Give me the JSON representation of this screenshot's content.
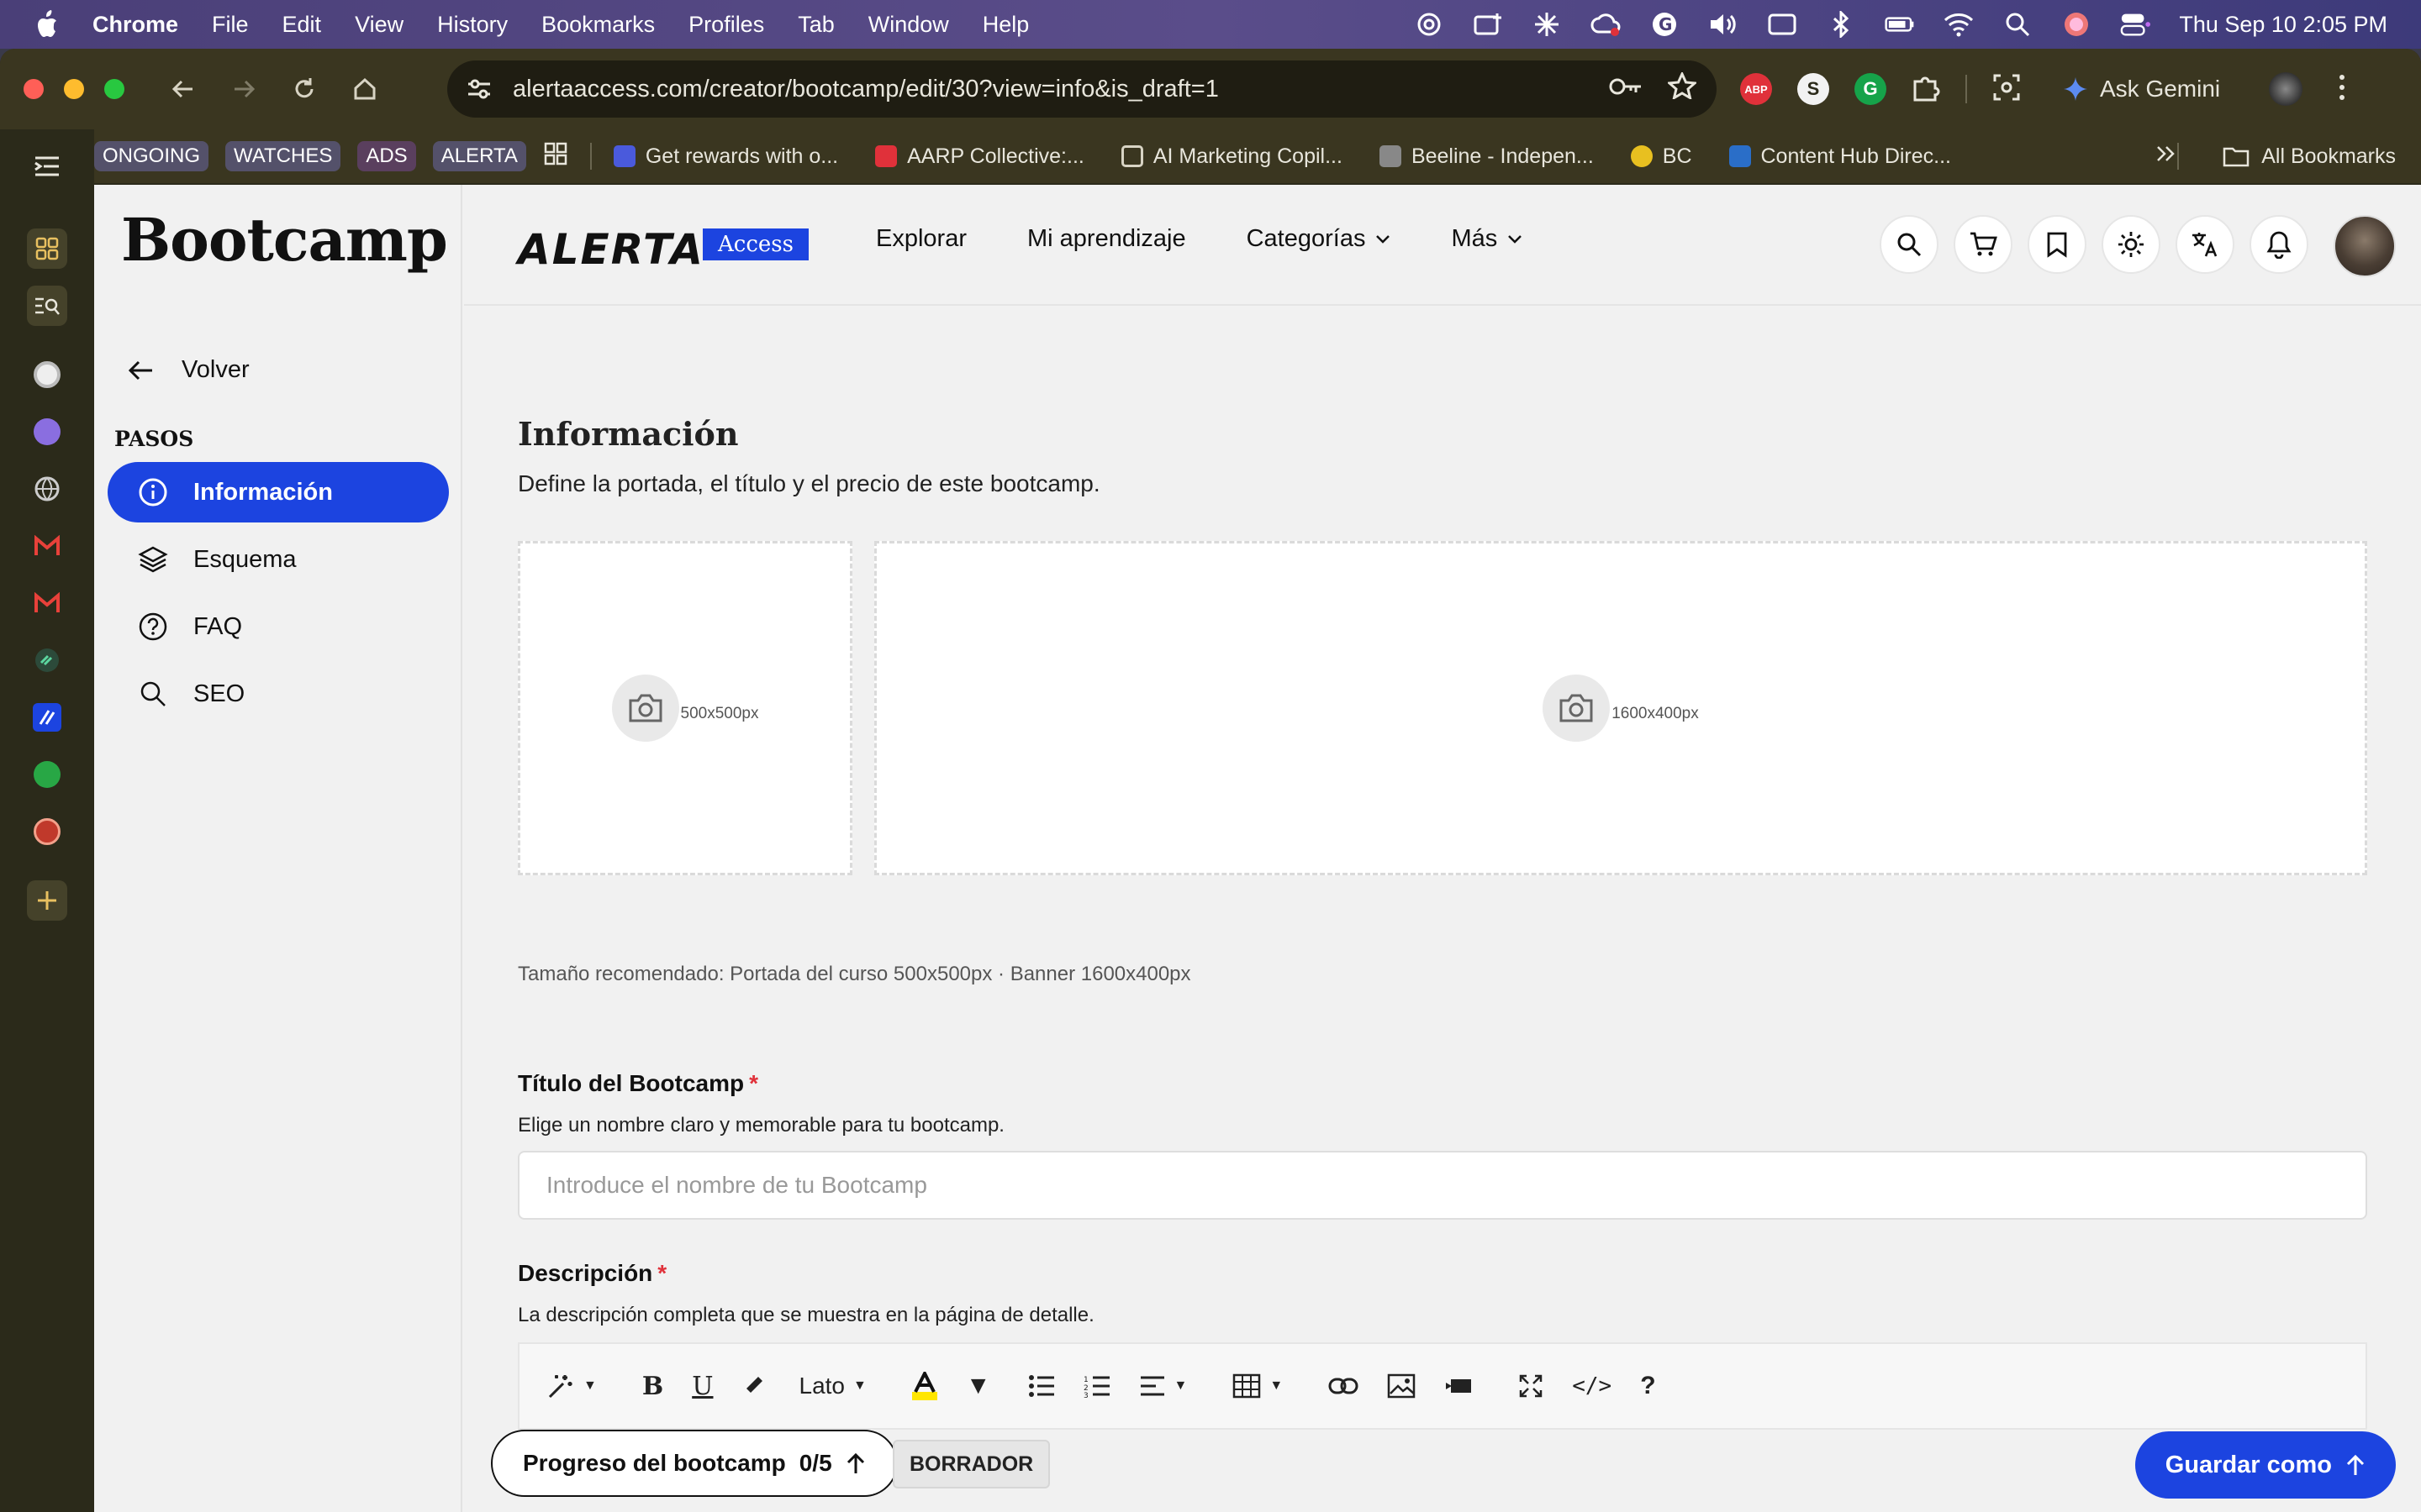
{
  "menubar": {
    "app": "Chrome",
    "items": [
      "File",
      "Edit",
      "View",
      "History",
      "Bookmarks",
      "Profiles",
      "Tab",
      "Window",
      "Help"
    ],
    "clock": "Thu Sep 10  2:05 PM"
  },
  "browser": {
    "url": "alertaaccess.com/creator/bootcamp/edit/30?view=info&is_draft=1",
    "gemini_label": "Ask Gemini",
    "extensions": [
      "ABP",
      "S",
      "G"
    ]
  },
  "bookmarks": {
    "chips": [
      "ONGOING",
      "WATCHES",
      "ADS",
      "ALERTA"
    ],
    "links": [
      {
        "label": "Get rewards with o...",
        "color": "#4a5adc"
      },
      {
        "label": "AARP Collective:...",
        "color": "#e0313a"
      },
      {
        "label": "AI Marketing Copil...",
        "color": "#2b2a1a"
      },
      {
        "label": "Beeline - Indepen...",
        "color": "#888888"
      },
      {
        "label": "BC",
        "color": "#e8c020"
      },
      {
        "label": "Content Hub Direc...",
        "color": "#2a6ec8"
      }
    ],
    "all_label": "All Bookmarks"
  },
  "steps_panel": {
    "title": "Bootcamp",
    "back_label": "Volver",
    "section": "PASOS",
    "steps": [
      {
        "label": "Información",
        "icon": "info-icon",
        "active": true
      },
      {
        "label": "Esquema",
        "icon": "layers-icon",
        "active": false
      },
      {
        "label": "FAQ",
        "icon": "question-icon",
        "active": false
      },
      {
        "label": "SEO",
        "icon": "search-icon",
        "active": false
      }
    ]
  },
  "topnav": {
    "logo_text": "ALERTA",
    "logo_badge": "Access",
    "links": [
      "Explorar",
      "Mi aprendizaje",
      "Categorías",
      "Más"
    ]
  },
  "form": {
    "title": "Información",
    "subtitle": "Define la portada, el título y el precio de este bootcamp.",
    "cover_size": "500x500px",
    "banner_size": "1600x400px",
    "hint": "Tamaño recomendado: Portada del curso 500x500px · Banner 1600x400px",
    "title_label": "Título del Bootcamp",
    "title_help": "Elige un nombre claro y memorable para tu bootcamp.",
    "title_placeholder": "Introduce el nombre de tu Bootcamp",
    "required_mark": "*",
    "desc_label": "Descripción",
    "desc_help": "La descripción completa que se muestra en la página de detalle.",
    "font_select": "Lato"
  },
  "bottombar": {
    "progress_label": "Progreso del bootcamp",
    "progress_count": "0/5",
    "draft_badge": "BORRADOR",
    "save_label": "Guardar como"
  },
  "colors": {
    "accent": "#1c44e0",
    "required": "#e0313a"
  }
}
